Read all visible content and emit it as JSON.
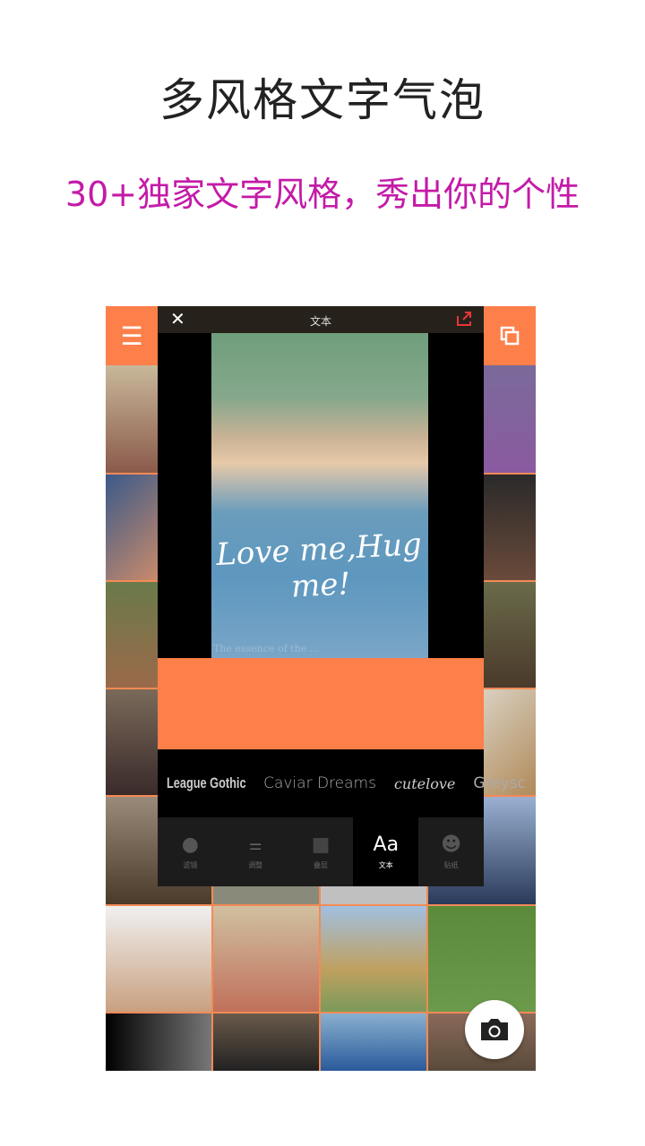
{
  "title": "多风格文字气泡",
  "subtitle": "30+独家文字风格，秀出你的个性",
  "dialog": {
    "title": "文本",
    "overlay_text": "Love me,Hug me!",
    "caption": "The essence of the ..."
  },
  "fonts": [
    "League Gothic",
    "Caviar Dreams",
    "cutelove",
    "Greysc"
  ],
  "tools": [
    {
      "label": "滤镜",
      "icon": "filter-icon"
    },
    {
      "label": "调整",
      "icon": "sliders-icon"
    },
    {
      "label": "叠层",
      "icon": "layers-icon"
    },
    {
      "label": "文本",
      "icon": "text-icon",
      "glyph": "Aa"
    },
    {
      "label": "贴纸",
      "icon": "sticker-icon"
    }
  ],
  "colors": {
    "accent": "#fd7f4a",
    "subtitle": "#c41aa8"
  }
}
